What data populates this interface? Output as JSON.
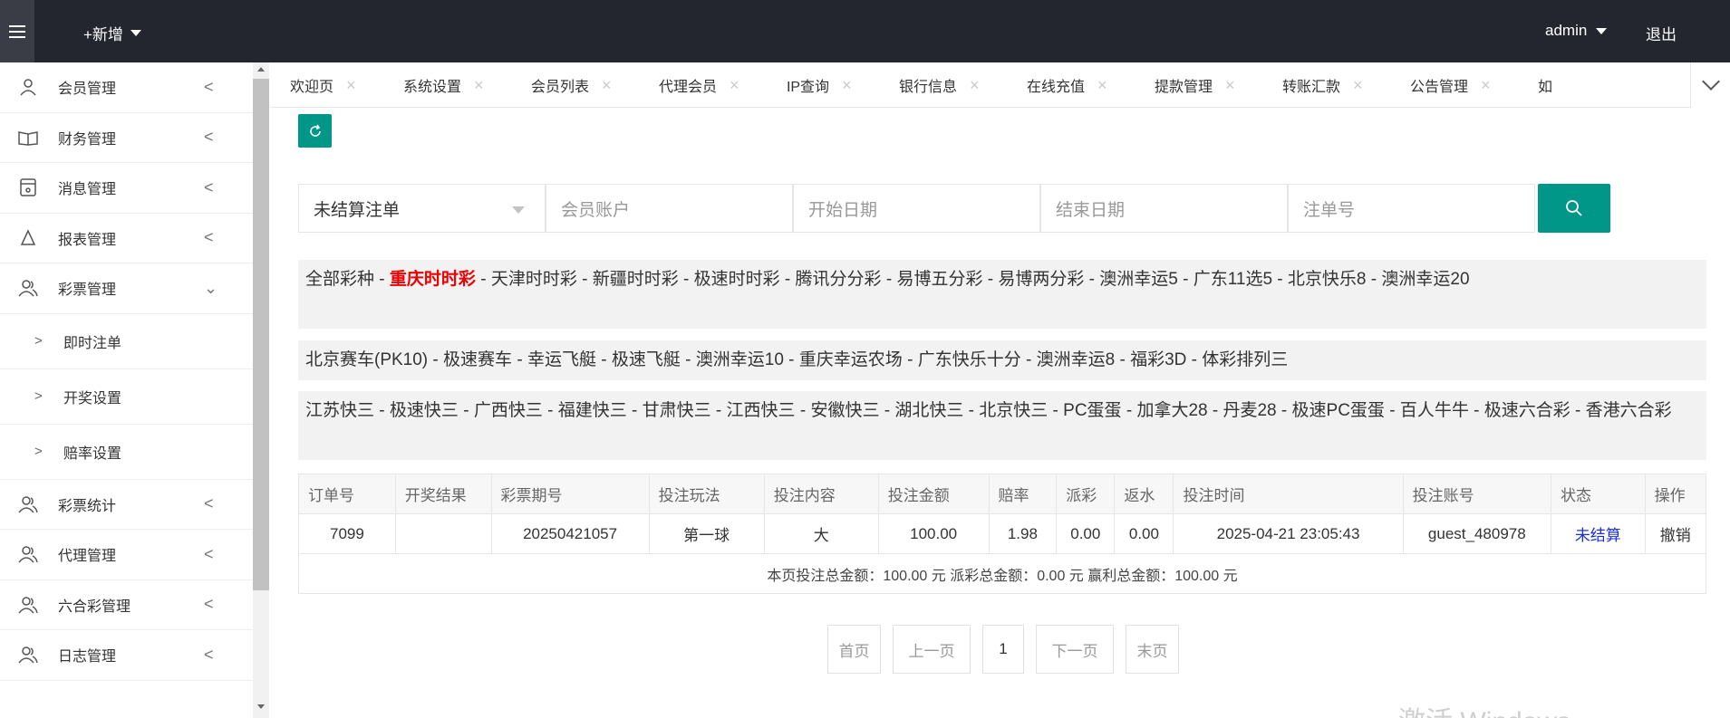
{
  "header": {
    "add_new": "+新增",
    "user": "admin",
    "logout": "退出"
  },
  "sidebar": {
    "items": [
      {
        "label": "会员管理",
        "icon": "user-icon",
        "expand": "<"
      },
      {
        "label": "财务管理",
        "icon": "book-icon",
        "expand": "<"
      },
      {
        "label": "消息管理",
        "icon": "message-icon",
        "expand": "<"
      },
      {
        "label": "报表管理",
        "icon": "report-icon",
        "expand": "<"
      },
      {
        "label": "彩票管理",
        "icon": "users-icon",
        "expand": "v"
      }
    ],
    "sub_items": [
      {
        "label": "即时注单"
      },
      {
        "label": "开奖设置"
      },
      {
        "label": "赔率设置"
      }
    ],
    "items_after": [
      {
        "label": "彩票统计",
        "icon": "users-icon"
      },
      {
        "label": "代理管理",
        "icon": "users-icon"
      },
      {
        "label": "六合彩管理",
        "icon": "users-icon"
      },
      {
        "label": "日志管理",
        "icon": "users-icon"
      }
    ]
  },
  "tabs": [
    "欢迎页",
    "系统设置",
    "会员列表",
    "代理会员",
    "IP查询",
    "银行信息",
    "在线充值",
    "提款管理",
    "转账汇款",
    "公告管理",
    "如"
  ],
  "search": {
    "status_selected": "未结算注单",
    "account_placeholder": "会员账户",
    "start_placeholder": "开始日期",
    "end_placeholder": "结束日期",
    "order_placeholder": "注单号"
  },
  "lotteries": {
    "row1": [
      "全部彩种",
      "重庆时时彩",
      "天津时时彩",
      "新疆时时彩",
      "极速时时彩",
      "腾讯分分彩",
      "易博五分彩",
      "易博两分彩",
      "澳洲幸运5",
      "广东11选5",
      "北京快乐8",
      "澳洲幸运20"
    ],
    "row1_active": "重庆时时彩",
    "row2": [
      "北京赛车(PK10)",
      "极速赛车",
      "幸运飞艇",
      "极速飞艇",
      "澳洲幸运10",
      "重庆幸运农场",
      "广东快乐十分",
      "澳洲幸运8",
      "福彩3D",
      "体彩排列三"
    ],
    "row3": [
      "江苏快三",
      "极速快三",
      "广西快三",
      "福建快三",
      "甘肃快三",
      "江西快三",
      "安徽快三",
      "湖北快三",
      "北京快三",
      "PC蛋蛋",
      "加拿大28",
      "丹麦28",
      "极速PC蛋蛋",
      "百人牛牛",
      "极速六合彩",
      "香港六合彩"
    ],
    "separator": " - "
  },
  "table": {
    "headers": [
      "订单号",
      "开奖结果",
      "彩票期号",
      "投注玩法",
      "投注内容",
      "投注金额",
      "赔率",
      "派彩",
      "返水",
      "投注时间",
      "投注账号",
      "状态",
      "操作"
    ],
    "rows": [
      [
        "7099",
        "",
        "20250421057",
        "第一球",
        "大",
        "100.00",
        "1.98",
        "0.00",
        "0.00",
        "2025-04-21 23:05:43",
        "guest_480978",
        "未结算",
        "撤销"
      ]
    ],
    "summary": "本页投注总金额：100.00 元 派彩总金额：0.00 元 赢利总金额：100.00 元"
  },
  "pager": {
    "first": "首页",
    "prev": "上一页",
    "current": "1",
    "next": "下一页",
    "last": "末页"
  },
  "watermark": "激活 Windows",
  "colors": {
    "topbar": "#23262e",
    "accent": "#009688",
    "active_lottery": "#ee0000",
    "status_link": "#1e2fd6"
  }
}
